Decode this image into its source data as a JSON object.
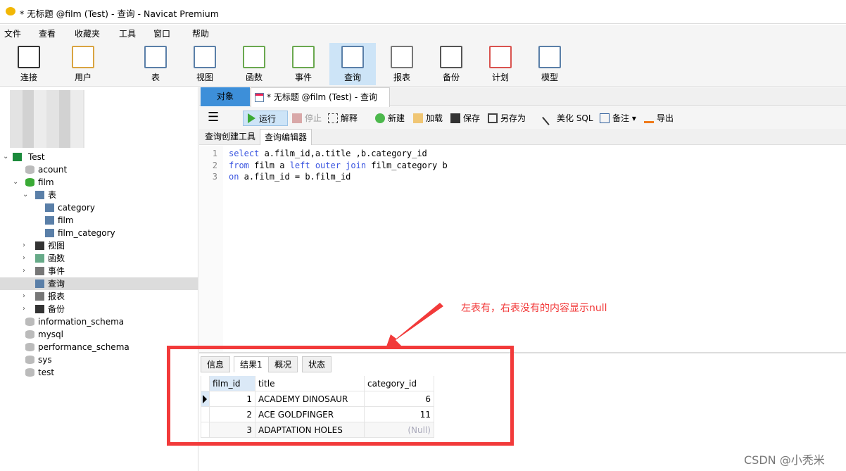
{
  "window": {
    "title": "* 无标题 @film (Test) - 查询 - Navicat Premium"
  },
  "menu": [
    "文件",
    "查看",
    "收藏夹",
    "工具",
    "窗口",
    "帮助"
  ],
  "toolbar": [
    {
      "label": "连接",
      "icon": "plug-icon"
    },
    {
      "label": "用户",
      "icon": "user-icon"
    },
    {
      "label": "表",
      "icon": "table-icon"
    },
    {
      "label": "视图",
      "icon": "view-icon"
    },
    {
      "label": "函数",
      "icon": "function-icon"
    },
    {
      "label": "事件",
      "icon": "event-icon"
    },
    {
      "label": "查询",
      "icon": "query-icon",
      "active": true
    },
    {
      "label": "报表",
      "icon": "report-icon"
    },
    {
      "label": "备份",
      "icon": "backup-icon"
    },
    {
      "label": "计划",
      "icon": "calendar-icon"
    },
    {
      "label": "模型",
      "icon": "model-icon"
    }
  ],
  "tree": [
    {
      "label": "Test",
      "level": 0,
      "arrow": "v",
      "icon": "connection"
    },
    {
      "label": "acount",
      "level": 1,
      "icon": "db-gray"
    },
    {
      "label": "film",
      "level": 1,
      "arrow": "v",
      "icon": "db-green"
    },
    {
      "label": "表",
      "level": 2,
      "arrow": "v",
      "icon": "table"
    },
    {
      "label": "category",
      "level": 3,
      "icon": "table"
    },
    {
      "label": "film",
      "level": 3,
      "icon": "table"
    },
    {
      "label": "film_category",
      "level": 3,
      "icon": "table"
    },
    {
      "label": "视图",
      "level": 2,
      "arrow": ">",
      "icon": "view"
    },
    {
      "label": "函数",
      "level": 2,
      "arrow": ">",
      "icon": "function"
    },
    {
      "label": "事件",
      "level": 2,
      "arrow": ">",
      "icon": "event"
    },
    {
      "label": "查询",
      "level": 2,
      "icon": "query",
      "selected": true
    },
    {
      "label": "报表",
      "level": 2,
      "arrow": ">",
      "icon": "report"
    },
    {
      "label": "备份",
      "level": 2,
      "arrow": ">",
      "icon": "backup"
    },
    {
      "label": "information_schema",
      "level": 1,
      "icon": "db-gray"
    },
    {
      "label": "mysql",
      "level": 1,
      "icon": "db-gray"
    },
    {
      "label": "performance_schema",
      "level": 1,
      "icon": "db-gray"
    },
    {
      "label": "sys",
      "level": 1,
      "icon": "db-gray"
    },
    {
      "label": "test",
      "level": 1,
      "icon": "db-gray"
    }
  ],
  "tabs": {
    "objects": "对象",
    "query": "* 无标题 @film (Test) - 查询"
  },
  "query_toolbar": {
    "run": "运行",
    "stop": "停止",
    "explain": "解释",
    "new": "新建",
    "load": "加载",
    "save": "保存",
    "save_as": "另存为",
    "beautify": "美化 SQL",
    "note": "备注",
    "export": "导出"
  },
  "subtabs": [
    "查询创建工具",
    "查询编辑器"
  ],
  "editor": {
    "lines": [
      "1",
      "2",
      "3"
    ]
  },
  "result": {
    "tabs": [
      "信息",
      "结果1",
      "概况",
      "状态"
    ],
    "columns": [
      "film_id",
      "title",
      "category_id"
    ],
    "rows": [
      [
        "1",
        "ACADEMY DINOSAUR",
        "6"
      ],
      [
        "2",
        "ACE GOLDFINGER",
        "11"
      ],
      [
        "3",
        "ADAPTATION HOLES",
        "(Null)"
      ]
    ]
  },
  "annotation": "左表有，右表没有的内容显示null",
  "watermark": "CSDN @小秃米",
  "colors": {
    "accent": "#3d8fd9",
    "annotation": "#f23a3a",
    "keyword": "#3a55e0"
  }
}
